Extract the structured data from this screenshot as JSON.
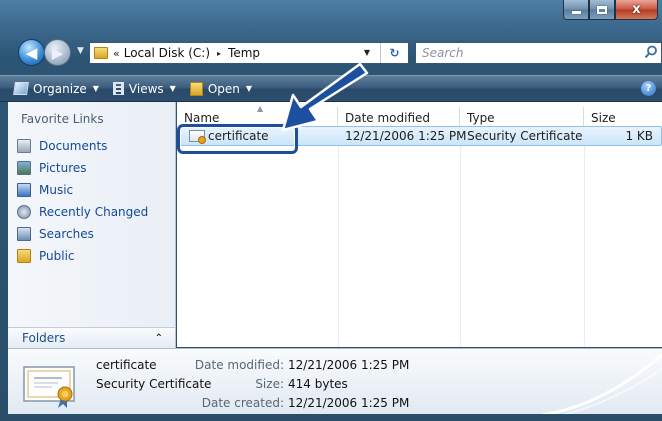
{
  "window": {
    "controls": {
      "minimize": "minimize-icon",
      "maximize": "maximize-icon",
      "close": "close-icon",
      "close_glyph": "x"
    }
  },
  "address": {
    "chevron": "«",
    "crumbs": [
      "Local Disk (C:)",
      "Temp"
    ],
    "separator": "▸",
    "search_placeholder": "Search"
  },
  "command_bar": {
    "organize": "Organize",
    "views": "Views",
    "open": "Open",
    "help_glyph": "?"
  },
  "nav": {
    "favorites_header": "Favorite Links",
    "items": [
      "Documents",
      "Pictures",
      "Music",
      "Recently Changed",
      "Searches",
      "Public"
    ],
    "folders_label": "Folders"
  },
  "file_list": {
    "columns": [
      "Name",
      "Date modified",
      "Type",
      "Size"
    ],
    "rows": [
      {
        "name": "certificate",
        "date": "12/21/2006 1:25 PM",
        "type": "Security Certificate",
        "size": "1 KB"
      }
    ]
  },
  "details": {
    "name": "certificate",
    "type": "Security Certificate",
    "date_modified_label": "Date modified:",
    "date_modified": "12/21/2006 1:25 PM",
    "size_label": "Size:",
    "size": "414 bytes",
    "date_created_label": "Date created:",
    "date_created": "12/21/2006 1:25 PM"
  },
  "colors": {
    "accent": "#1d4fa0",
    "link": "#15489a",
    "selection": "#cbe5fa"
  }
}
